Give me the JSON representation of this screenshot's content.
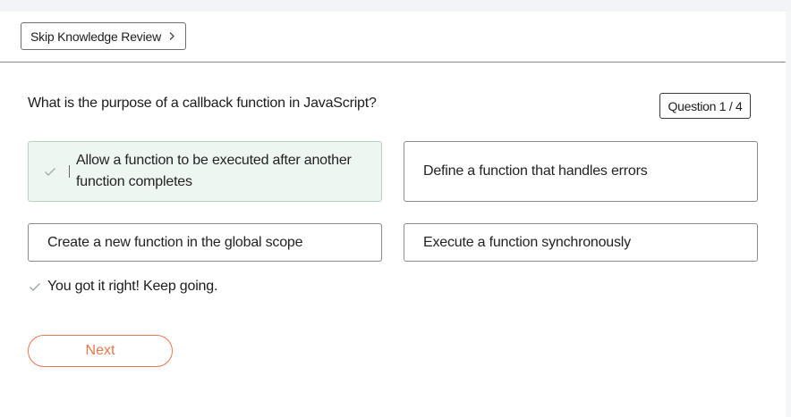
{
  "header": {
    "skip_label": "Skip Knowledge Review"
  },
  "quiz": {
    "question": "What is the purpose of a callback function in JavaScript?",
    "counter": "Question 1 / 4",
    "options": [
      {
        "label": "Allow a function to be executed after another function completes",
        "state": "correct"
      },
      {
        "label": "Define a function that handles errors",
        "state": "default"
      },
      {
        "label": "Create a new function in the global scope",
        "state": "default"
      },
      {
        "label": "Execute a function synchronously",
        "state": "default"
      }
    ],
    "feedback": "You got it right! Keep going.",
    "next_label": "Next"
  },
  "icons": {
    "skip": "chevron-right-icon",
    "option_correct": "check-icon",
    "feedback": "check-icon"
  },
  "colors": {
    "accent": "#e8774d",
    "correct_bg": "#eef6f1",
    "correct_border": "#b4d4bf",
    "check": "#9aa8a0"
  }
}
